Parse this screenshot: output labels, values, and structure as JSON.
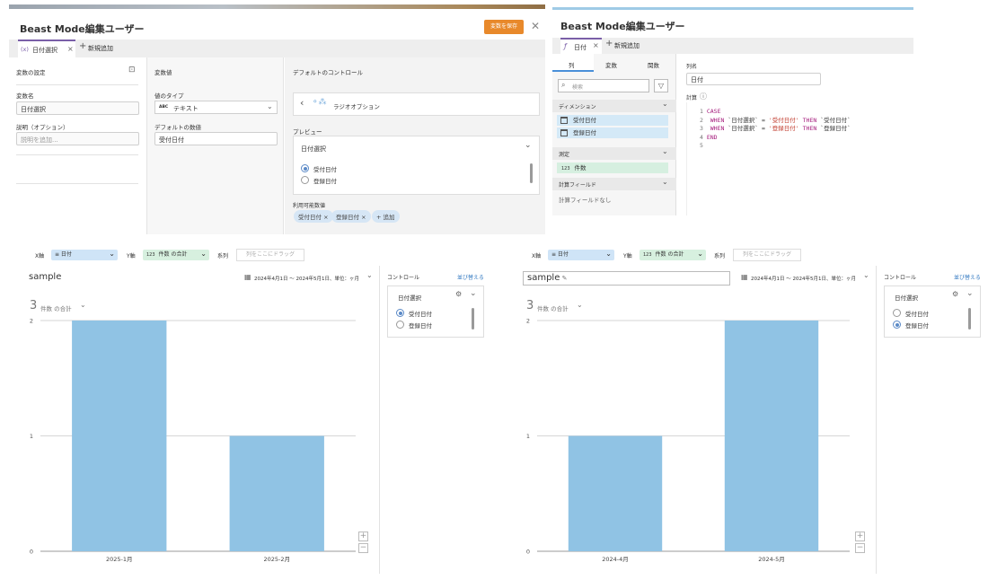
{
  "colors": {
    "accent": "#e8892b",
    "bar": "#90c3e4",
    "chip": "#d6e6f5",
    "pill_x": "#cfe4f7",
    "pill_y": "#d7f0df"
  },
  "left_editor": {
    "title": "Beast Mode編集ユーザー",
    "save_label": "変数を保存",
    "tab_label": "日付選択",
    "tab_prefix": "(x)",
    "add_label": "新規追加",
    "col1": {
      "header": "変数の設定",
      "name_label": "変数名",
      "name_value": "日付選択",
      "desc_label": "説明（オプション）",
      "desc_placeholder": "説明を追加..."
    },
    "col2": {
      "header": "変数値",
      "type_label": "値のタイプ",
      "type_badge": "ABC",
      "type_value": "テキスト",
      "default_label": "デフォルトの数値",
      "default_value": "受付日付"
    },
    "col3": {
      "header": "デフォルトのコントロール",
      "control_name": "ラジオオプション",
      "preview_label": "プレビュー",
      "preview_title": "日付選択",
      "options": [
        "受付日付",
        "登録日付"
      ],
      "available_label": "利用可能数値",
      "chips": [
        "受付日付",
        "登録日付"
      ],
      "add_chip": "+ 追加"
    }
  },
  "right_editor": {
    "title": "Beast Mode編集ユーザー",
    "tab_prefix": "ƒ",
    "tab_label": "日付",
    "add_label": "新規追加",
    "side_tabs": [
      "列",
      "変数",
      "関数"
    ],
    "search_placeholder": "検索",
    "dimension_label": "ディメンション",
    "dimension_items": [
      "受付日付",
      "登録日付"
    ],
    "measure_label": "測定",
    "measure_badge": "123",
    "measure_items": [
      "件数"
    ],
    "calc_label": "計算フィールド",
    "calc_empty": "計算フィールドなし",
    "col_name_label": "列名",
    "col_name_value": "日付",
    "calc_section_label": "計算",
    "code_lines": [
      {
        "n": "1",
        "parts": [
          {
            "t": "CASE",
            "c": "kw"
          }
        ]
      },
      {
        "n": "2",
        "parts": [
          {
            "t": " WHEN",
            "c": "kw"
          },
          {
            "t": " `日付選択` = ",
            "c": ""
          },
          {
            "t": "'受付日付'",
            "c": "str"
          },
          {
            "t": " THEN",
            "c": "kw"
          },
          {
            "t": " `受付日付`",
            "c": ""
          }
        ]
      },
      {
        "n": "3",
        "parts": [
          {
            "t": " WHEN",
            "c": "kw"
          },
          {
            "t": " `日付選択` = ",
            "c": ""
          },
          {
            "t": "'登録日付'",
            "c": "str"
          },
          {
            "t": " THEN",
            "c": "kw"
          },
          {
            "t": " `登録日付`",
            "c": ""
          }
        ]
      },
      {
        "n": "4",
        "parts": [
          {
            "t": "END",
            "c": "kw"
          }
        ]
      },
      {
        "n": "5",
        "parts": []
      }
    ]
  },
  "analyzers": [
    {
      "shelf": {
        "x_label": "X軸",
        "x_pill": "≡ 日付",
        "y_label": "Y軸",
        "y_pill_badge": "123",
        "y_pill": "件数 の合計",
        "series_label": "系列",
        "drop_placeholder": "列をここにドラッグ"
      },
      "card_title": "sample",
      "date_range": "2024年4月1日 ～ 2024年5月1日、単位：ヶ月",
      "summary_number": "3",
      "summary_label": "件数 の合計",
      "controls_header": "コントロール",
      "sort_label": "並び替える",
      "control_title": "日付選択",
      "options": [
        "受付日付",
        "登録日付"
      ],
      "selected": 0,
      "zoom_in": "+",
      "zoom_out": "−"
    },
    {
      "shelf": {
        "x_label": "X軸",
        "x_pill": "≡ 日付",
        "y_label": "Y軸",
        "y_pill_badge": "123",
        "y_pill": "件数 の合計",
        "series_label": "系列",
        "drop_placeholder": "列をここにドラッグ"
      },
      "card_title": "sample",
      "date_range": "2024年4月1日 ～ 2024年5月1日、単位：ヶ月",
      "summary_number": "3",
      "summary_label": "件数 の合計",
      "controls_header": "コントロール",
      "sort_label": "並び替える",
      "control_title": "日付選択",
      "options": [
        "受付日付",
        "登録日付"
      ],
      "selected": 1,
      "zoom_in": "+",
      "zoom_out": "−"
    }
  ],
  "chart_data": [
    {
      "type": "bar",
      "categories": [
        "2025-1月",
        "2025-2月"
      ],
      "values": [
        2,
        1
      ],
      "title": "sample",
      "xlabel": "",
      "ylabel": "",
      "ylim": [
        0,
        2
      ],
      "yticks": [
        0,
        1,
        2
      ],
      "grid": true
    },
    {
      "type": "bar",
      "categories": [
        "2024-4月",
        "2024-5月"
      ],
      "values": [
        1,
        2
      ],
      "title": "sample",
      "xlabel": "",
      "ylabel": "",
      "ylim": [
        0,
        2
      ],
      "yticks": [
        0,
        1,
        2
      ],
      "grid": true
    }
  ]
}
